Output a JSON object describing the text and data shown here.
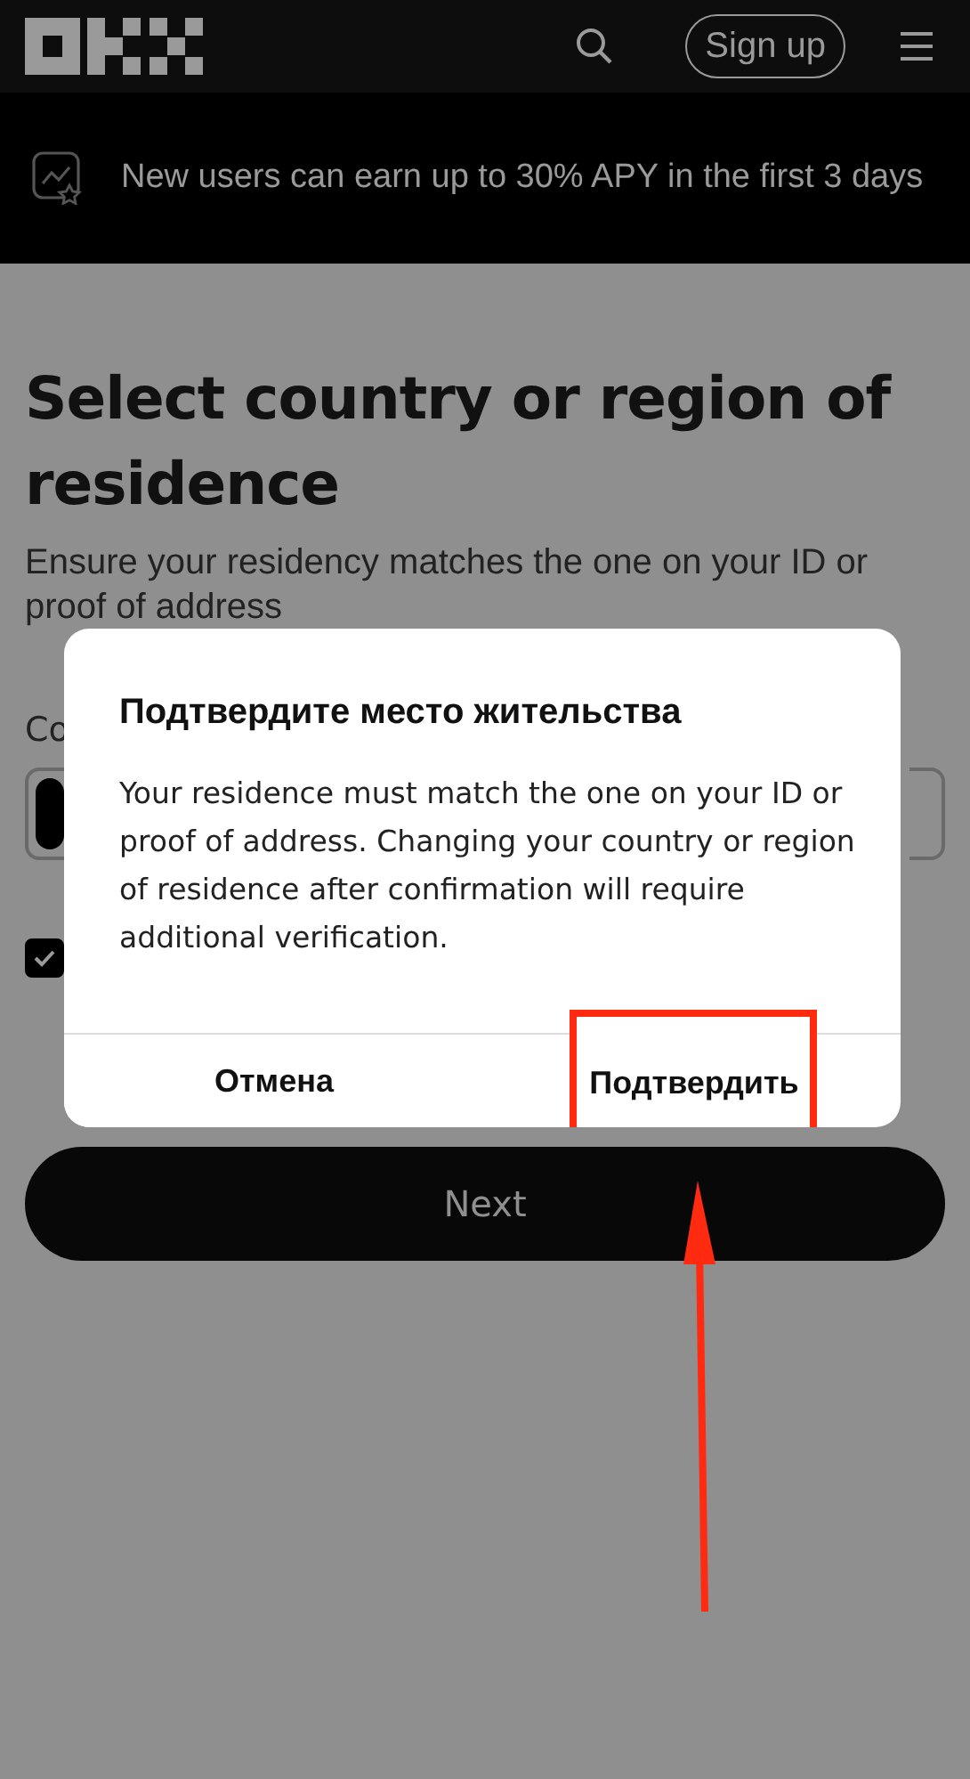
{
  "header": {
    "signup": "Sign up"
  },
  "promo": {
    "text": "New users can earn up to 30% APY in the first 3 days"
  },
  "sheet": {
    "title": "Select country or region of residence",
    "subtitle": "Ensure your residency matches the one on your ID or proof of address",
    "field_label": "Co",
    "agree": {
      "checked": true
    },
    "next": "Next"
  },
  "dialog": {
    "title": "Подтвердите место жительства",
    "body": "Your residence must match the one on your ID or proof of address. Changing your country or region of residence after confirmation will require additional verification.",
    "buttons": [
      {
        "label": "Отмена",
        "highlighted": false
      },
      {
        "label": "Подтвердить",
        "highlighted": true
      }
    ]
  }
}
